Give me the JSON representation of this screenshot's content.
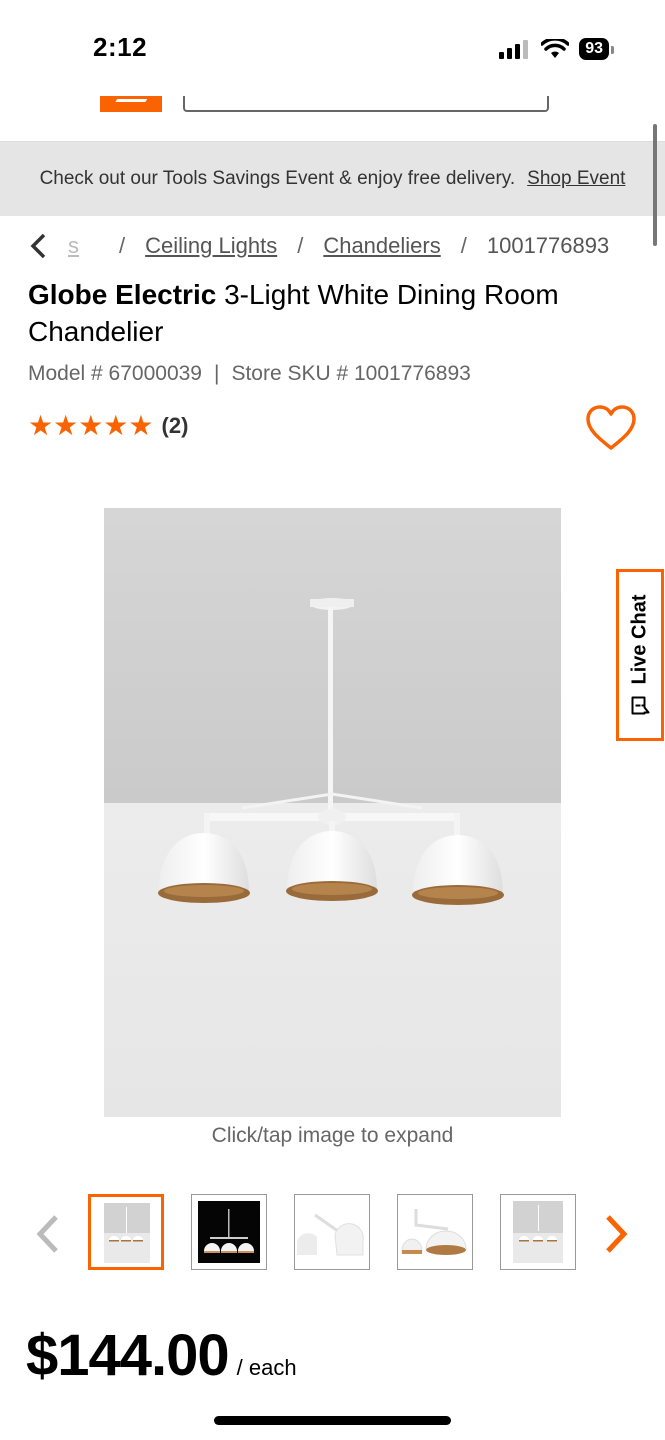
{
  "status_bar": {
    "time": "2:12",
    "battery": "93"
  },
  "promo": {
    "text": "Check out our Tools Savings Event & enjoy free delivery.",
    "link": "Shop Event"
  },
  "breadcrumb": {
    "faded": "s",
    "items": [
      "Ceiling Lights",
      "Chandeliers"
    ],
    "current": "1001776893"
  },
  "product": {
    "brand": "Globe Electric",
    "title": " 3-Light White Dining Room Chandelier",
    "model_label": "Model # 67000039",
    "sku_label": "Store SKU # 1001776893",
    "stars": "★★★★★",
    "rating_count": "(2)",
    "image_caption": "Click/tap image to expand"
  },
  "live_chat": {
    "label": "Live Chat"
  },
  "thumbnails": {
    "count": 5,
    "active_index": 0
  },
  "price": {
    "value": "$144.00",
    "unit": "/ each"
  },
  "colors": {
    "brand_orange": "#f96302",
    "banner_bg": "#e5e5e5"
  },
  "icons": [
    "signal-icon",
    "wifi-icon",
    "battery-icon",
    "back-chevron-icon",
    "heart-icon",
    "chat-icon",
    "chevron-left-icon",
    "chevron-right-icon"
  ]
}
